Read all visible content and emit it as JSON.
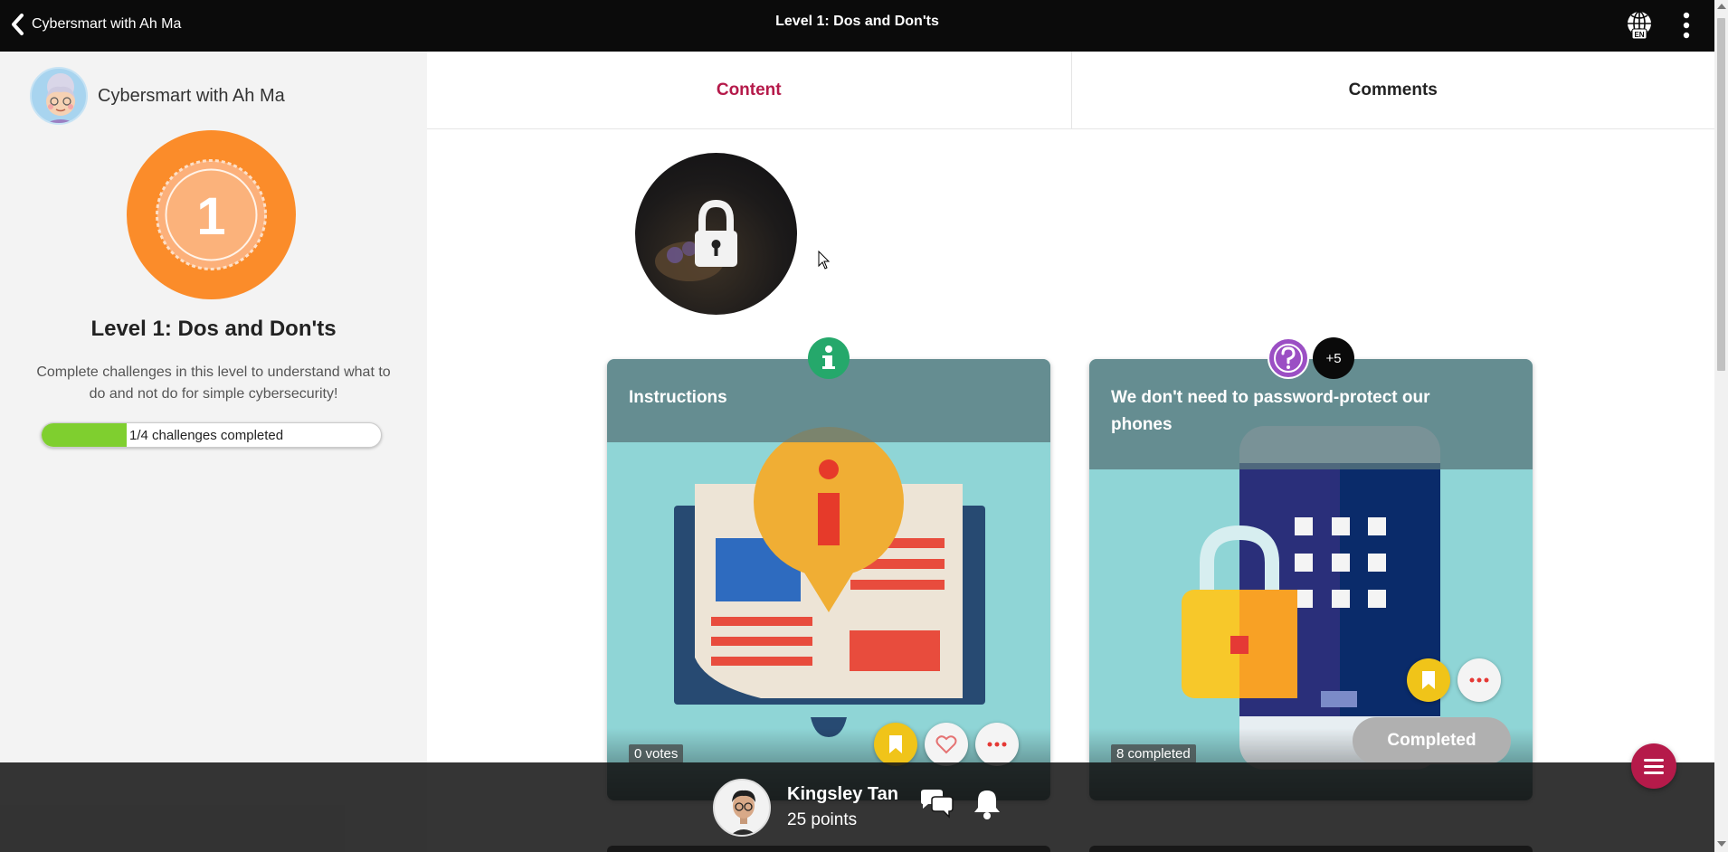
{
  "topbar": {
    "back_label": "Cybersmart with Ah Ma",
    "title": "Level 1: Dos and Don'ts",
    "language": "EN"
  },
  "sidebar": {
    "name": "Cybersmart with Ah Ma",
    "badge_number": "1",
    "level_title": "Level 1: Dos and Don'ts",
    "description": "Complete challenges in this level to understand what to do and not do for simple cybersecurity!",
    "progress_label": "1/4 challenges completed",
    "progress_fraction": 0.25
  },
  "tabs": [
    {
      "label": "Content",
      "active": true
    },
    {
      "label": "Comments",
      "active": false
    }
  ],
  "cards": [
    {
      "title": "Instructions",
      "stat": "0 votes",
      "type_icon": "info-icon"
    },
    {
      "title": "We don't need to password-protect our phones",
      "stat": "8 completed",
      "status": "Completed",
      "type_icon": "question-icon",
      "extra": "+5"
    }
  ],
  "bottom_bar": {
    "user_name": "Kingsley Tan",
    "points": "25 points"
  },
  "colors": {
    "accent": "#b51a4a",
    "badge": "#fb8c2a",
    "progress": "#7fcf2f",
    "card_bg": "#8fd5d6",
    "info": "#25a86b",
    "question": "#9b4fc4",
    "bookmark": "#f0c419"
  }
}
